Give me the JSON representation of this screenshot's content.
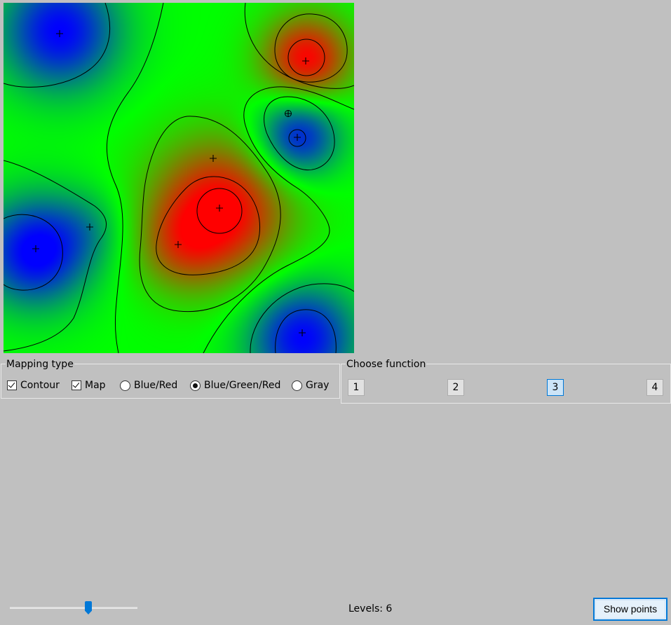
{
  "mapping": {
    "title": "Mapping type",
    "options": [
      {
        "label": "Contour",
        "type": "checkbox",
        "checked": true
      },
      {
        "label": "Map",
        "type": "checkbox",
        "checked": true
      },
      {
        "label": "Blue/Red",
        "type": "radio",
        "checked": false
      },
      {
        "label": "Blue/Green/Red",
        "type": "radio",
        "checked": true
      },
      {
        "label": "Gray",
        "type": "radio",
        "checked": false
      }
    ]
  },
  "function_chooser": {
    "title": "Choose function",
    "buttons": [
      "1",
      "2",
      "3",
      "4"
    ],
    "selected": "3"
  },
  "levels": {
    "label": "Levels: 6",
    "value": 6
  },
  "show_points": {
    "label": "Show points"
  },
  "plot": {
    "color_scheme": "Blue/Green/Red",
    "colors": {
      "low": "#0000ff",
      "mid": "#00ff00",
      "high": "#ff0000",
      "contour": "#000000"
    }
  }
}
